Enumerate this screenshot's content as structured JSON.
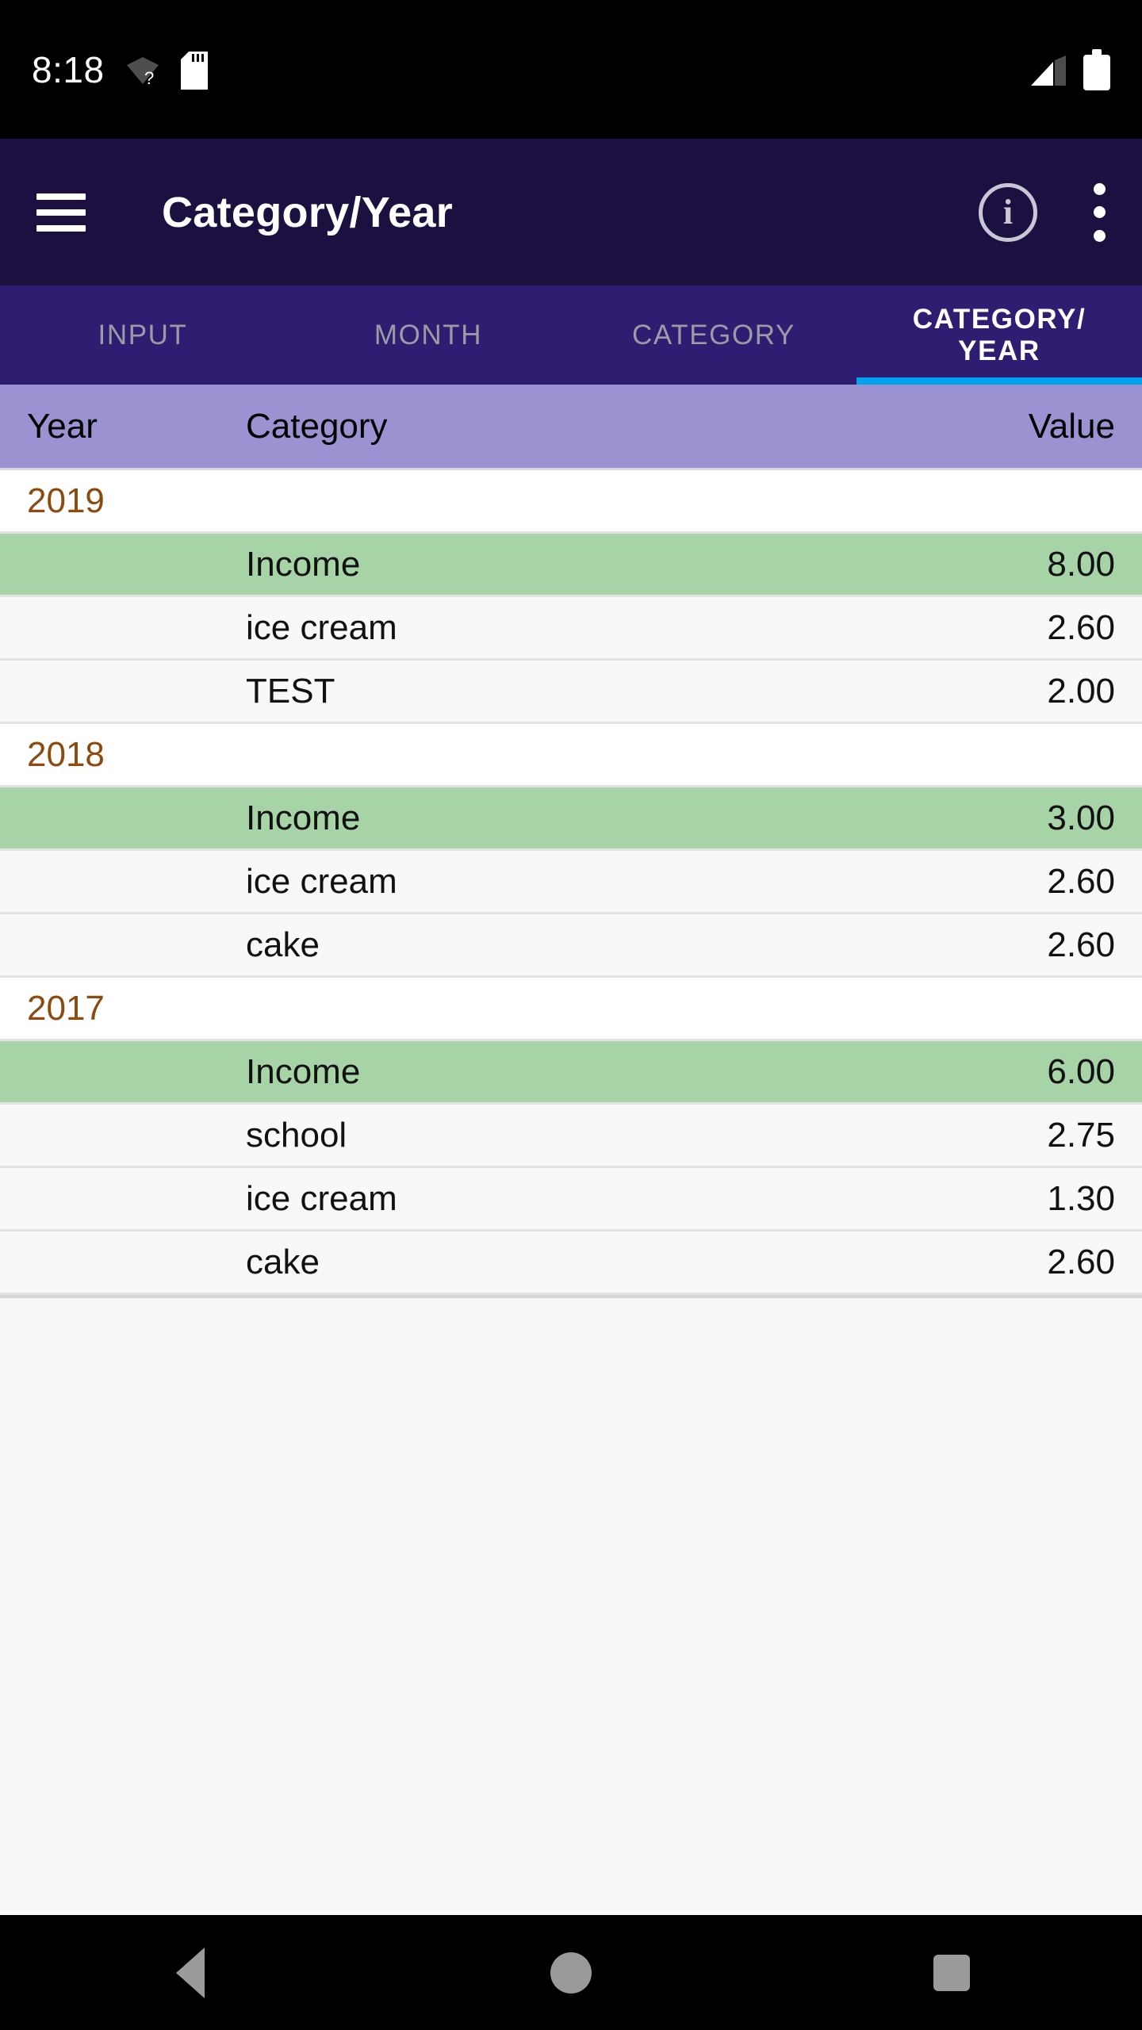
{
  "status_bar": {
    "clock": "8:18",
    "icons": [
      "wifi-no-connection-icon",
      "sdcard-icon",
      "signal-icon",
      "battery-icon"
    ]
  },
  "app_bar": {
    "menu_icon": "hamburger-menu-icon",
    "title": "Category/Year",
    "info_label": "i",
    "info_icon": "info-circle-icon",
    "overflow_icon": "overflow-menu-icon"
  },
  "tabs": {
    "items": [
      {
        "label": "INPUT",
        "active": false
      },
      {
        "label": "MONTH",
        "active": false
      },
      {
        "label": "CATEGORY",
        "active": false
      },
      {
        "label": "CATEGORY/\nYEAR",
        "active": true
      }
    ],
    "active_index": 3,
    "indicator_color": "#00a3ef"
  },
  "table": {
    "headers": {
      "year": "Year",
      "category": "Category",
      "value": "Value"
    },
    "groups": [
      {
        "year": "2019",
        "rows": [
          {
            "category": "Income",
            "value": "8.00",
            "highlight": true
          },
          {
            "category": "ice cream",
            "value": "2.60",
            "highlight": false
          },
          {
            "category": "TEST",
            "value": "2.00",
            "highlight": false
          }
        ]
      },
      {
        "year": "2018",
        "rows": [
          {
            "category": "Income",
            "value": "3.00",
            "highlight": true
          },
          {
            "category": "ice cream",
            "value": "2.60",
            "highlight": false
          },
          {
            "category": "cake",
            "value": "2.60",
            "highlight": false
          }
        ]
      },
      {
        "year": "2017",
        "rows": [
          {
            "category": "Income",
            "value": "6.00",
            "highlight": true
          },
          {
            "category": "school",
            "value": "2.75",
            "highlight": false
          },
          {
            "category": "ice cream",
            "value": "1.30",
            "highlight": false
          },
          {
            "category": "cake",
            "value": "2.60",
            "highlight": false
          }
        ]
      }
    ]
  },
  "nav_bar": {
    "back_icon": "back-triangle-icon",
    "home_icon": "home-circle-icon",
    "recents_icon": "recents-square-icon"
  },
  "colors": {
    "app_bar": "#1b1040",
    "tab_bar": "#2e1d70",
    "table_header": "#9b93d1",
    "income_highlight": "#a7d4a7",
    "year_text": "#8a4a10",
    "accent": "#00a3ef"
  }
}
